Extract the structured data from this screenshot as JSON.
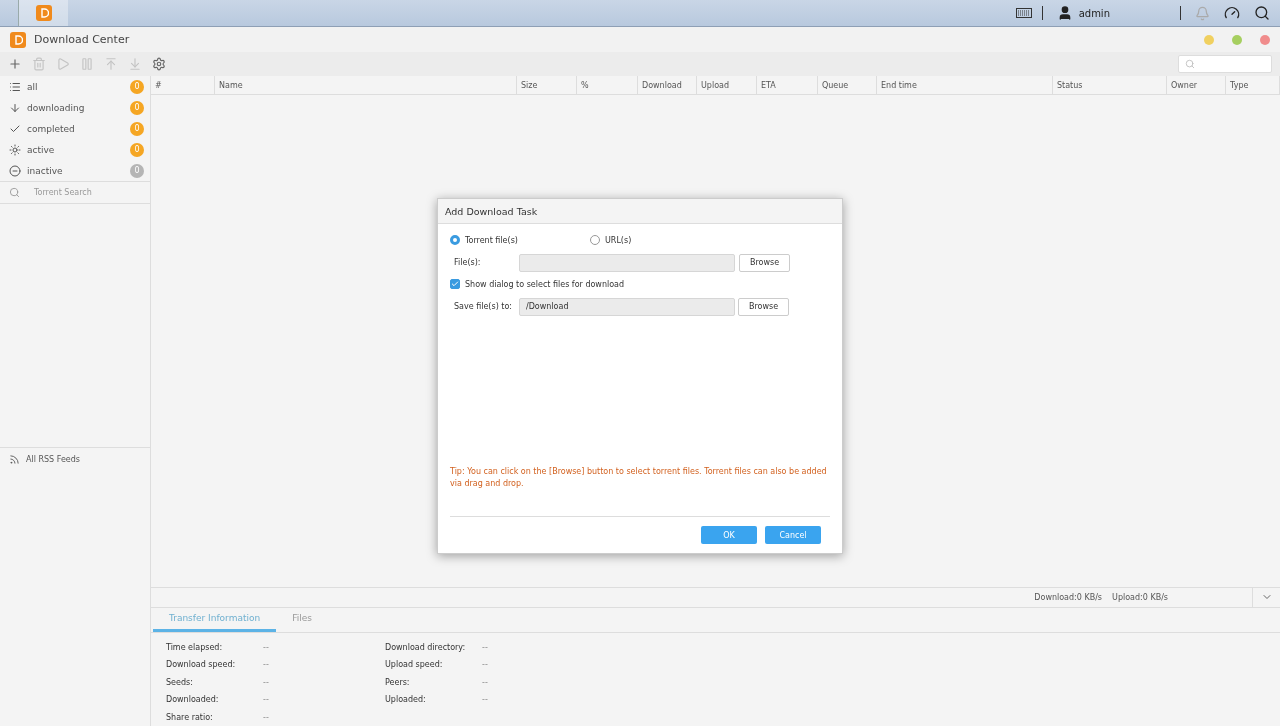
{
  "taskbar": {
    "user": "admin"
  },
  "window": {
    "title": "Download Center"
  },
  "toolbar": [
    {
      "kind": "add",
      "disabled": false
    },
    {
      "kind": "delete",
      "disabled": true
    },
    {
      "kind": "resume",
      "disabled": true
    },
    {
      "kind": "pause",
      "disabled": true
    },
    {
      "kind": "top",
      "disabled": true
    },
    {
      "kind": "bottom",
      "disabled": true
    },
    {
      "kind": "settings",
      "disabled": false
    }
  ],
  "sidebar": {
    "filters": [
      {
        "kind": "all",
        "label": "all",
        "count": "0",
        "color": "#f5a623"
      },
      {
        "kind": "downloading",
        "label": "downloading",
        "count": "0",
        "color": "#f5a623"
      },
      {
        "kind": "completed",
        "label": "completed",
        "count": "0",
        "color": "#f5a623"
      },
      {
        "kind": "active",
        "label": "active",
        "count": "0",
        "color": "#f5a623"
      },
      {
        "kind": "inactive",
        "label": "inactive",
        "count": "0",
        "color": "#b5b5b5"
      }
    ],
    "search_placeholder": "Torrent Search",
    "rss": "All RSS Feeds"
  },
  "table": {
    "columns": [
      "#",
      "Name",
      "Size",
      "%",
      "Download",
      "Upload",
      "ETA",
      "Queue",
      "End time",
      "Status",
      "Owner",
      "Type"
    ]
  },
  "status_bar": {
    "download": "Download:0 KB/s",
    "upload": "Upload:0 KB/s"
  },
  "tabs": [
    {
      "label": "Transfer Information",
      "selected": true
    },
    {
      "label": "Files",
      "selected": false
    }
  ],
  "info": {
    "left": [
      {
        "label": "Time elapsed:",
        "value": "--"
      },
      {
        "label": "Download speed:",
        "value": "--"
      },
      {
        "label": "Seeds:",
        "value": "--"
      },
      {
        "label": "Downloaded:",
        "value": "--"
      },
      {
        "label": "Share ratio:",
        "value": "--"
      }
    ],
    "right": [
      {
        "label": "Download directory:",
        "value": "--"
      },
      {
        "label": "Upload speed:",
        "value": "--"
      },
      {
        "label": "Peers:",
        "value": "--"
      },
      {
        "label": "Uploaded:",
        "value": "--"
      }
    ]
  },
  "dialog": {
    "title": "Add Download Task",
    "sources": [
      {
        "label": "Torrent file(s)",
        "selected": true
      },
      {
        "label": "URL(s)",
        "selected": false
      }
    ],
    "files_label": "File(s):",
    "files_browse": "Browse",
    "show_dialog": {
      "label": "Show dialog to select files for download",
      "checked": true
    },
    "save_label": "Save file(s) to:",
    "save_value": "/Download",
    "save_browse": "Browse",
    "tip": "Tip: You can click on the [Browse] button to select torrent files. Torrent files can also be added via drag and drop.",
    "ok": "OK",
    "cancel": "Cancel"
  }
}
